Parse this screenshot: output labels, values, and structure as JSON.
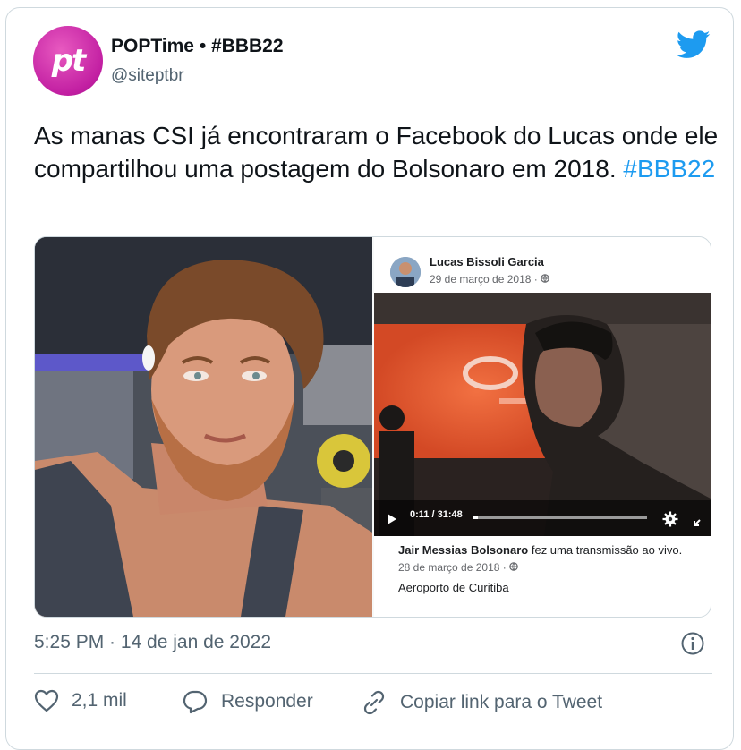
{
  "header": {
    "avatar_text": "pt",
    "display_name": "POPTime • #BBB22",
    "handle": "@siteptbr"
  },
  "tweet": {
    "text": "As manas CSI já encontraram o Facebook do Lucas onde ele compartilhou uma postagem do Bolsonaro em 2018.",
    "hashtag": "#BBB22"
  },
  "facebook_post": {
    "author": "Lucas Bissoli Garcia",
    "date": "29 de março de 2018 ·",
    "video_time": "0:11 / 31:48",
    "shared_author": "Jair Messias Bolsonaro",
    "shared_action": " fez uma transmissão ao vivo.",
    "shared_date": "28 de março de 2018 ·",
    "location": "Aeroporto de Curitiba"
  },
  "meta": {
    "timestamp": "5:25 PM · 14 de jan de 2022"
  },
  "actions": {
    "likes": "2,1 mil",
    "reply": "Responder",
    "copy_link": "Copiar link para o Tweet"
  },
  "colors": {
    "accent": "#1d9bf0",
    "brand_avatar": "#c21fa2",
    "text_primary": "#0f1419",
    "text_secondary": "#536471"
  },
  "icons": [
    "twitter-bird-icon",
    "info-icon",
    "heart-icon",
    "reply-icon",
    "link-icon",
    "play-icon",
    "settings-icon",
    "fullscreen-icon",
    "globe-icon"
  ]
}
